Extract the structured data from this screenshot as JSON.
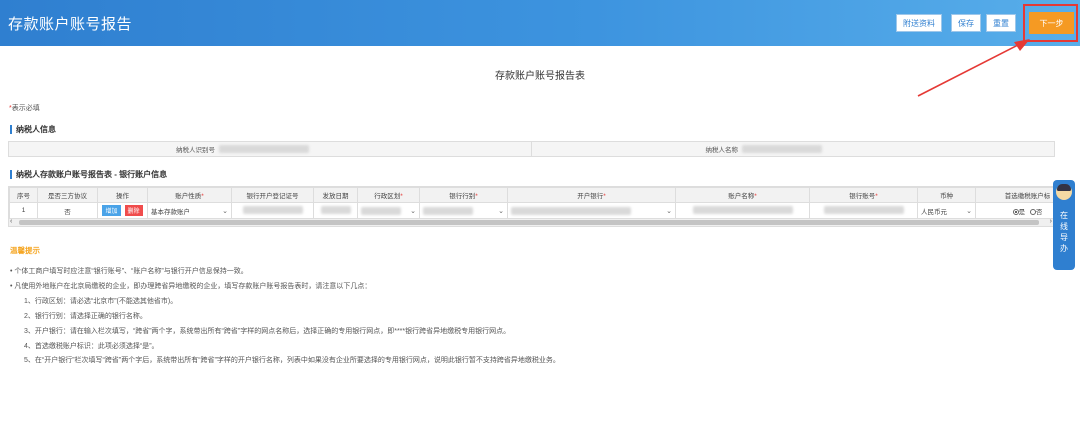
{
  "header": {
    "title": "存款账户账号报告",
    "buttons": {
      "attach": "附送资料",
      "save": "保存",
      "reset": "重置",
      "next": "下一步"
    }
  },
  "form": {
    "title": "存款账户账号报告表",
    "required_mark": "*",
    "required_note": "表示必填"
  },
  "taxpayer": {
    "section_title": "纳税人信息",
    "id_label": "纳税人识别号",
    "name_label": "纳税人名称"
  },
  "accounts": {
    "section_title": "纳税人存款账户账号报告表 - 银行账户信息",
    "columns": [
      "序号",
      "是否三方协议",
      "操作",
      "账户性质",
      "银行开户登记证号",
      "发放日期",
      "行政区划",
      "银行行别",
      "开户银行",
      "账户名称",
      "银行账号",
      "币种",
      "首选缴税账户标"
    ],
    "required_columns": [
      3,
      6,
      7,
      8,
      9,
      10
    ],
    "row": {
      "index": "1",
      "tripartite": "否",
      "add_label": "增加",
      "delete_label": "删除",
      "account_type": "基本存款账户",
      "currency": "人民币元",
      "preferred_yes": "是",
      "preferred_no": "否"
    }
  },
  "tips": {
    "title": "温馨提示",
    "lines": [
      "• 个体工商户填写时应注意“银行账号”、“账户名称”与银行开户信息保持一致。",
      "• 凡使用外地账户在北京局缴税的企业，即办理跨省异地缴税的企业，填写存款账户账号报告表时，请注意以下几点：",
      "1、行政区划：请必选“北京市”(不能选其他省市)。",
      "2、银行行别：请选择正确的银行名称。",
      "3、开户银行：请在输入栏次填写，“跨省”两个字，系统带出所有“跨省”字样的网点名称后，选择正确的专用银行网点，即****银行跨省异地缴税专用银行网点。",
      "4、首选缴税账户标识：此项必须选择“是”。",
      "5、在“开户银行”栏次填写“跨省”两个字后，系统带出所有“跨省”字样的开户银行名称，列表中如果没有企业所要选择的专用银行网点，说明此银行暂不支持跨省异地缴税业务。"
    ]
  },
  "side_widget": {
    "label": "在线导办"
  },
  "colors": {
    "header_blue": "#2f7fd0",
    "next_orange": "#f59a23",
    "annotation_red": "#e53935"
  }
}
